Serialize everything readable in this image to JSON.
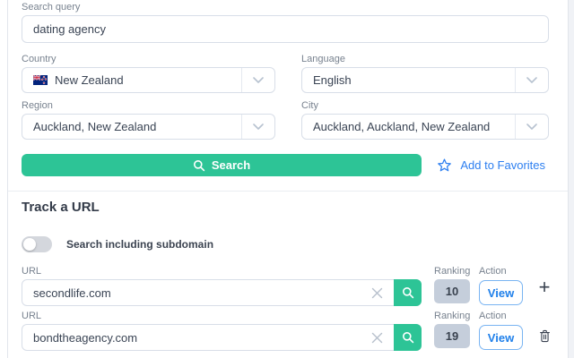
{
  "form": {
    "search_query": {
      "label": "Search query",
      "value": "dating agency"
    },
    "country": {
      "label": "Country",
      "value": "New Zealand"
    },
    "language": {
      "label": "Language",
      "value": "English"
    },
    "region": {
      "label": "Region",
      "value": "Auckland, New Zealand"
    },
    "city": {
      "label": "City",
      "value": "Auckland, Auckland, New Zealand"
    },
    "search_button_label": "Search",
    "add_to_favorites_label": "Add to Favorites"
  },
  "track": {
    "heading": "Track a URL",
    "subdomain_toggle": {
      "label": "Search including subdomain",
      "state": "off"
    },
    "url_rows": [
      {
        "label": "URL",
        "value": "secondlife.com",
        "ranking_label": "Ranking",
        "ranking": "10",
        "action_label": "Action",
        "view_label": "View",
        "row_icon": "add-row-icon"
      },
      {
        "label": "URL",
        "value": "bondtheagency.com",
        "ranking_label": "Ranking",
        "ranking": "19",
        "action_label": "Action",
        "view_label": "View",
        "row_icon": "delete-row-icon"
      }
    ]
  },
  "icons": {
    "search-icon": "magnifier",
    "chevron-down-icon": "chevron-down",
    "clear-icon": "x-cross",
    "favorite-star-icon": "star-outline",
    "add-row-icon": "+",
    "delete-row-icon": "trash-can",
    "new-zealand-flag-icon": "nz-flag"
  },
  "colors": {
    "accent_green": "#2dc496",
    "link_blue": "#2d7ff0",
    "badge_bg": "#c5cedb",
    "toggle_off": "#d4d7dd"
  }
}
